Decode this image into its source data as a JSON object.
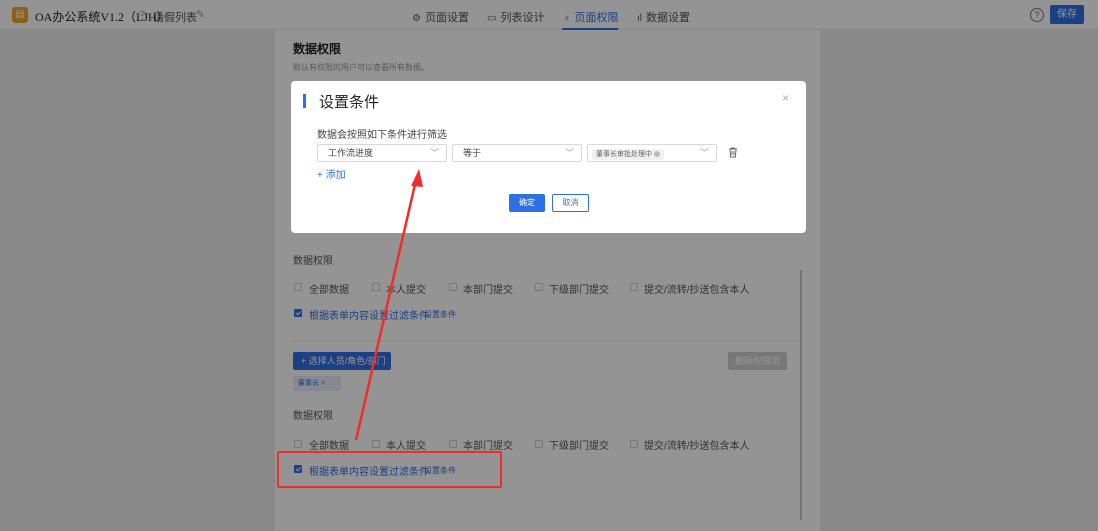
{
  "topbar": {
    "app_title": "OA办公系统V1.2（LJH）",
    "breadcrumb_sep": ">",
    "breadcrumb": "请假列表",
    "tabs": [
      {
        "icon": "⚙",
        "label": "页面设置"
      },
      {
        "icon": "▭",
        "label": "列表设计"
      },
      {
        "icon": "♁",
        "label": "页面权限"
      },
      {
        "icon": "ıl",
        "label": "数据设置"
      }
    ],
    "active_tab": "页面权限",
    "help_icon": "?",
    "save_label": "保存",
    "accent_color": "#2f6fe4"
  },
  "page": {
    "title": "数据权限",
    "description": "默认有权限的用户可以查看所有数据。"
  },
  "group1": {
    "section_label": "数据权限",
    "options": [
      "全部数据",
      "本人提交",
      "本部门提交",
      "下级部门提交",
      "提交/流转/抄送包含本人"
    ],
    "filter_option": "根据表单内容设置过滤条件",
    "filter_link": "设置条件",
    "filter_checked": true
  },
  "group2": {
    "select_button": "+ 选择人员/角色/部门",
    "delete_button": "删除权限组",
    "tag": "董事长",
    "tag_close": "×",
    "section_label": "数据权限",
    "options": [
      "全部数据",
      "本人提交",
      "本部门提交",
      "下级部门提交",
      "提交/流转/抄送包含本人"
    ],
    "filter_option": "根据表单内容设置过滤条件",
    "filter_link": "设置条件",
    "filter_checked": true
  },
  "modal": {
    "title": "设置条件",
    "close": "×",
    "description": "数据会按照如下条件进行筛选",
    "field": "工作流进度",
    "operator": "等于",
    "value_chip": "董事长审批处理中",
    "add_label": "+ 添加",
    "ok_label": "确定",
    "cancel_label": "取消"
  },
  "annotation_color": "#ef2d2d"
}
